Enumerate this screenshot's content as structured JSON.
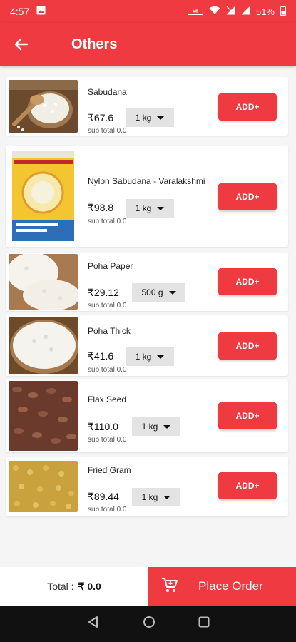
{
  "status_bar": {
    "time": "4:57",
    "battery": "51%",
    "net": "VoWiFi"
  },
  "app_bar": {
    "title": "Others"
  },
  "products": [
    {
      "name": "Sabudana",
      "price": "₹67.6",
      "unit": "1 kg",
      "subtotal": "sub total 0.0",
      "add": "ADD+"
    },
    {
      "name": "Nylon Sabudana - Varalakshmi",
      "price": "₹98.8",
      "unit": "1 kg",
      "subtotal": "sub total 0.0",
      "add": "ADD+"
    },
    {
      "name": "Poha Paper",
      "price": "₹29.12",
      "unit": "500 g",
      "subtotal": "sub total 0.0",
      "add": "ADD+"
    },
    {
      "name": "Poha Thick",
      "price": "₹41.6",
      "unit": "1 kg",
      "subtotal": "sub total 0.0",
      "add": "ADD+"
    },
    {
      "name": "Flax Seed",
      "price": "₹110.0",
      "unit": "1 kg",
      "subtotal": "sub total 0.0",
      "add": "ADD+"
    },
    {
      "name": "Fried Gram",
      "price": "₹89.44",
      "unit": "1 kg",
      "subtotal": "sub total 0.0",
      "add": "ADD+"
    }
  ],
  "footer": {
    "total_label": "Total :",
    "total_value": "₹ 0.0",
    "place_order": "Place Order"
  },
  "colors": {
    "primary": "#ee3a40",
    "background": "#f5f5f5"
  }
}
